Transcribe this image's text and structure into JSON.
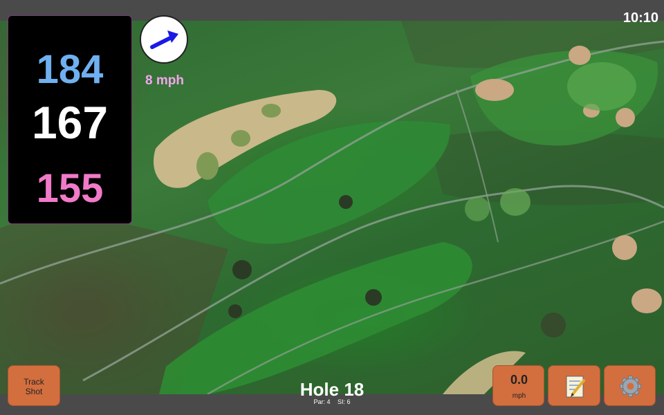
{
  "status": {
    "time": "10:10"
  },
  "distances": {
    "back": "184",
    "center": "167",
    "front": "155"
  },
  "wind": {
    "speed": "8 mph",
    "direction_icon": "wind-arrow-icon"
  },
  "hole": {
    "title": "Hole 18",
    "par": "Par: 4",
    "stroke_index": "SI: 6"
  },
  "buttons": {
    "track_line1": "Track",
    "track_line2": "Shot",
    "speed_value": "0.0",
    "speed_unit": "mph",
    "notes_icon": "notepad-icon",
    "settings_icon": "gear-icon"
  },
  "colors": {
    "back": "#6fb0f0",
    "center": "#ffffff",
    "front": "#f07ac8",
    "button": "#d36e3e",
    "wind_text": "#f3a6ee"
  }
}
